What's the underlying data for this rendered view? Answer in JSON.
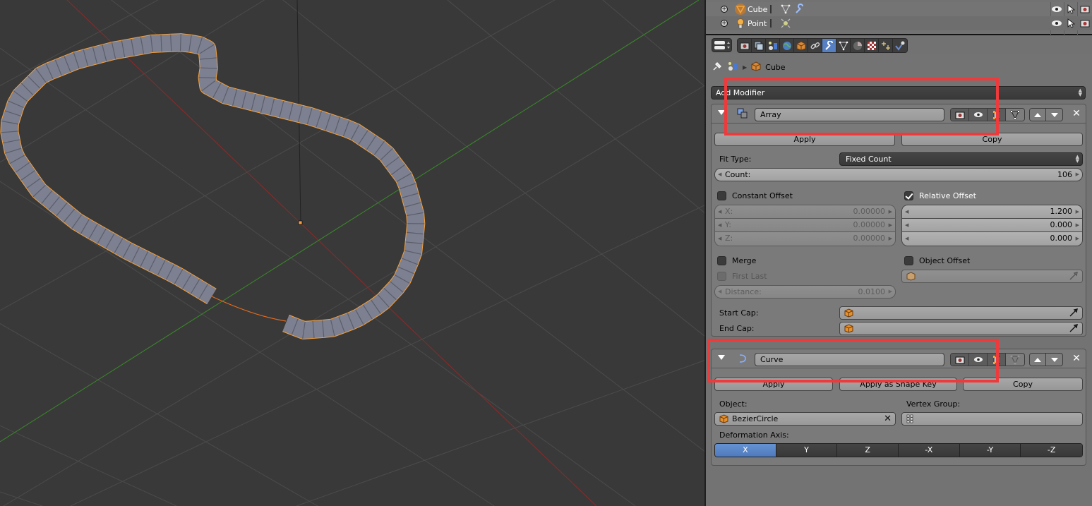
{
  "outliner": {
    "rows": [
      {
        "name": "Cube",
        "type": "mesh",
        "modifier_icons": [
          "mesh-data-icon",
          "wrench-icon"
        ]
      },
      {
        "name": "Point",
        "type": "lamp",
        "modifier_icons": [
          "lamp-data-icon"
        ]
      }
    ]
  },
  "properties": {
    "tabs": [
      "render",
      "render-layers",
      "scene",
      "world",
      "object",
      "constraints",
      "modifiers",
      "data",
      "material",
      "texture",
      "particles",
      "physics"
    ],
    "active_tab": "modifiers",
    "breadcrumb": {
      "object": "Cube"
    },
    "add_modifier_label": "Add Modifier"
  },
  "array": {
    "name": "Array",
    "apply_label": "Apply",
    "copy_label": "Copy",
    "fit_type_label": "Fit Type:",
    "fit_type_value": "Fixed Count",
    "count_label": "Count:",
    "count_value": "106",
    "constant_offset_label": "Constant Offset",
    "constant_offset_checked": false,
    "constant": {
      "x_label": "X:",
      "x": "0.00000",
      "y_label": "Y:",
      "y": "0.00000",
      "z_label": "Z:",
      "z": "0.00000"
    },
    "relative_offset_label": "Relative Offset",
    "relative_offset_checked": true,
    "relative": {
      "x": "1.200",
      "y": "0.000",
      "z": "0.000"
    },
    "merge_label": "Merge",
    "merge_checked": false,
    "first_last_label": "First Last",
    "object_offset_label": "Object Offset",
    "object_offset_checked": false,
    "distance_label": "Distance:",
    "distance_value": "0.0100",
    "start_cap_label": "Start Cap:",
    "end_cap_label": "End Cap:"
  },
  "curve": {
    "name": "Curve",
    "apply_label": "Apply",
    "apply_shape_key_label": "Apply as Shape Key",
    "copy_label": "Copy",
    "object_label": "Object:",
    "object_value": "BezierCircle",
    "vertex_group_label": "Vertex Group:",
    "deformation_axis_label": "Deformation Axis:",
    "axes": [
      "X",
      "Y",
      "Z",
      "-X",
      "-Y",
      "-Z"
    ],
    "active_axis": "X"
  },
  "colors": {
    "accent": "#5680c2",
    "selection_outline": "#f5a03c",
    "highlight_box": "#f0393b",
    "x_axis": "#8b2a2a",
    "y_axis": "#3a8a2a",
    "viewport_bg": "#393939"
  }
}
